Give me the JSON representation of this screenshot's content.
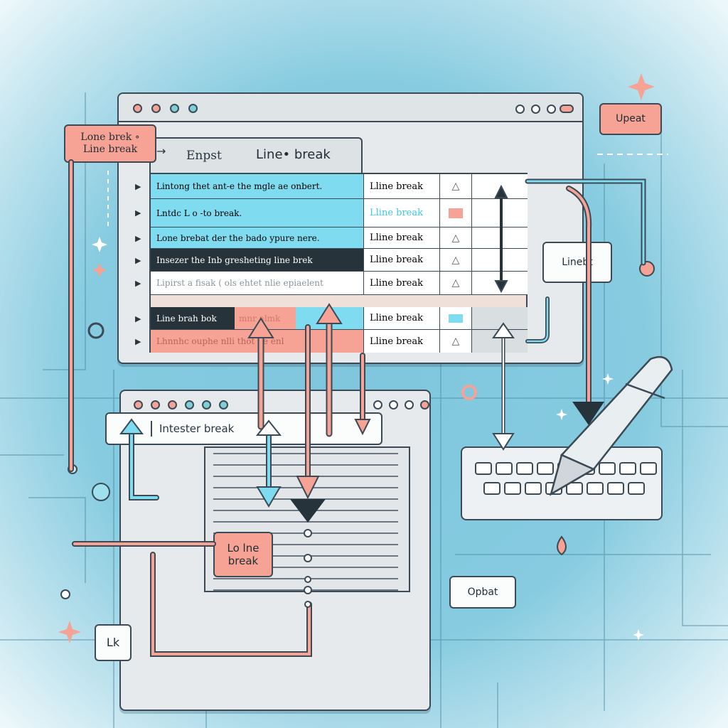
{
  "colors": {
    "accent_salmon": "#f6a294",
    "accent_cyan": "#7fdcf0",
    "outline": "#3b4a55",
    "background": "#86cbe0"
  },
  "top_window": {
    "panel_header": {
      "left": "Enpst",
      "right": "Line• break"
    },
    "rows": [
      {
        "text": "Lintong thet ant-e the mgle ae onbert.",
        "style": "cyan",
        "col2": "Lline break",
        "icon": "triangle-icon"
      },
      {
        "text": "Lntdc L o -to break.",
        "style": "cyan",
        "col2": "Lline break",
        "icon": "minus-badge-icon"
      },
      {
        "text": "Lone brebat der the bado ypure nere.",
        "style": "cyan",
        "col2": "Lline break",
        "icon": "triangle-icon"
      },
      {
        "text": "Insezer the Inb gresheting line brek",
        "style": "dark",
        "col2": "Lline break",
        "icon": "triangle-icon"
      },
      {
        "text": "Lipirst a fisak ( ols ehtet nlie epiaelent",
        "style": "white",
        "col2": "Lline break",
        "icon": "triangle-icon"
      },
      {
        "text": "Line brah bok",
        "extra": "mnr almk",
        "style": "dark-split",
        "col2": "Lline break",
        "icon": "cyan-badge-icon"
      },
      {
        "text": "Lhnnhc ouphe nlli  thot ne  enl",
        "style": "salmon",
        "col2": "Lline break",
        "icon": "triangle-icon"
      }
    ]
  },
  "labels": {
    "top_left": [
      "Lone brek ∘",
      "Line break"
    ],
    "top_right": "Upeat",
    "mid_right": "Linebt",
    "doc_callout": [
      "Lo lne",
      "break"
    ],
    "bottom_left": "Lk",
    "bottom_right": "Opbat"
  },
  "bottom_window": {
    "input_value": "Intester break"
  }
}
